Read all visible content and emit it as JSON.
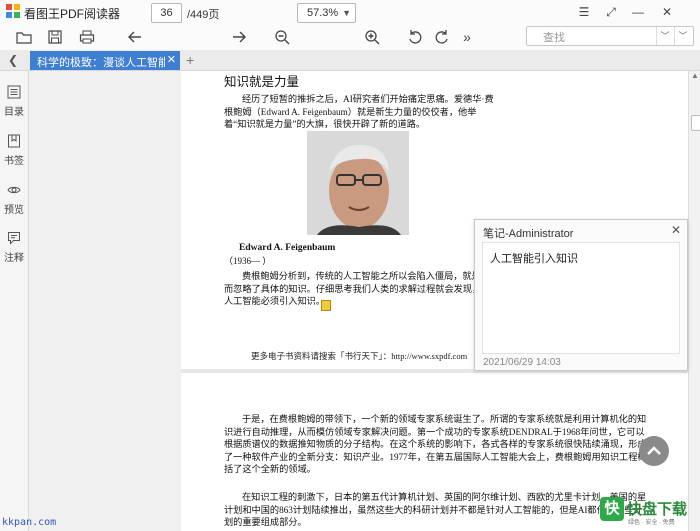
{
  "window": {
    "title": "看图王PDF阅读器",
    "controls": [
      "☰",
      "⤢",
      "—",
      "✕"
    ]
  },
  "toolbar": {
    "current_page": "36",
    "total_pages": "/449页",
    "zoom": "57.3%",
    "search_placeholder": "查找",
    "more": "»"
  },
  "tabs": {
    "collapse": "❮",
    "active_label": "科学的极致：漫谈人工智能.pdf",
    "close": "✕",
    "new": "+"
  },
  "sidebar": {
    "items": [
      {
        "label": "目录",
        "icon": "list-icon"
      },
      {
        "label": "书签",
        "icon": "bookmark-icon"
      },
      {
        "label": "预览",
        "icon": "eye-icon"
      },
      {
        "label": "注释",
        "icon": "comment-icon"
      }
    ]
  },
  "document": {
    "section_title": "知识就是力量",
    "intro": "经历了短暂的推拆之后，AI研究者们开始痛定思痛。爱德华·费根鲍姆（Edward A. Feigenbaum）就是新生力量的佼佼者，他举着“知识就是力量”的大旗，很快开辟了新的道路。",
    "caption_name": "Edward A. Feigenbaum",
    "caption_years": "（1936—  ）",
    "para2": "费根鲍姆分析到，传统的人工智能之所以会陷入僵局，就是因为他们过于强调通用求解方法的作用，而忽略了具体的知识。仔细思考我们人类的求解过程就会发现，知识无时无刻不在起着重要作用。因此，人工智能必须引入知识。",
    "footer": "更多电子书资料请搜索「书行天下」：http://www.sxpdf.com",
    "page2_para1": "于是，在费根鲍姆的带领下，一个新的领域专家系统诞生了。所谓的专家系统就是利用计算机化的知识进行自动推理，从而模仿领域专家解决问题。第一个成功的专家系统DENDRAL于1968年问世，它可以根据质谱仪的数据推知物质的分子结构。在这个系统的影响下，各式各样的专家系统很快陆续涌现，形成了一种软件产业的全新分支：知识产业。1977年，在第五届国际人工智能大会上，费根鲍姆用知识工程概括了这个全新的领域。",
    "page2_para2": "在知识工程的刺激下，日本的第五代计算机计划、英国的阿尔维计划、西欧的尤里卡计划、美国的星计划和中国的863计划陆续推出，虽然这些大的科研计划并不都是针对人工智能的，但是AI都作为这些计划的重要组成部分。"
  },
  "note": {
    "title": "笔记-Administrator",
    "close": "✕",
    "content": "人工智能引入知识",
    "date": "2021/06/29 14:03"
  },
  "watermark": {
    "left": "kkpan.com",
    "badge": "快",
    "brand": "快盘下载",
    "sub": "绿色 · 安全 · 免费"
  },
  "colors": {
    "tab_active": "#3f7fd2",
    "watermark_green": "#2fa84a"
  }
}
